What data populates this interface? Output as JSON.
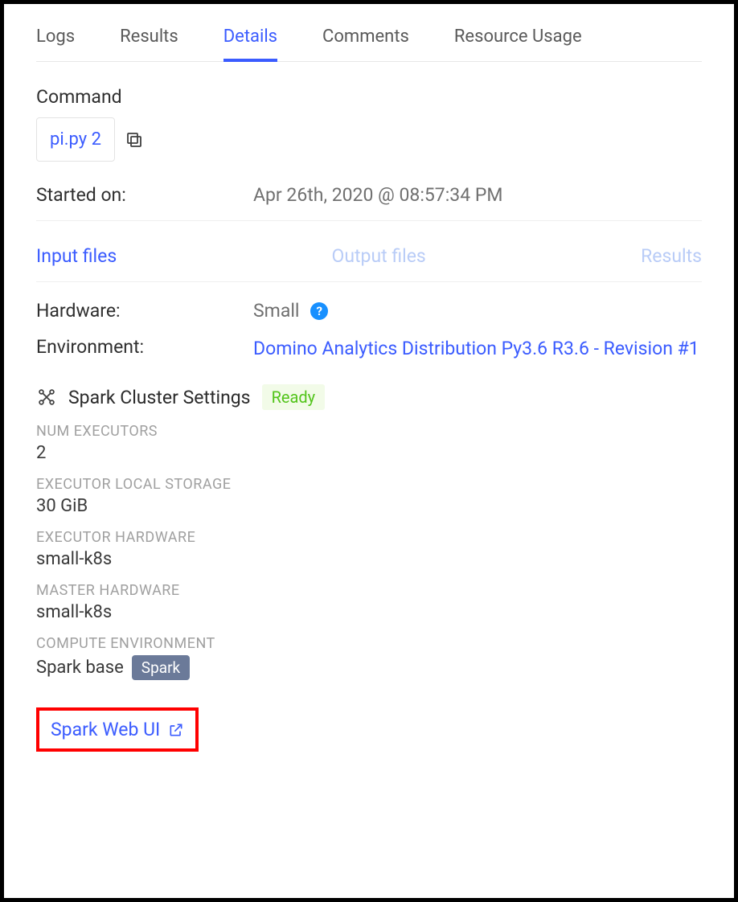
{
  "tabs": {
    "logs": "Logs",
    "results": "Results",
    "details": "Details",
    "comments": "Comments",
    "resource_usage": "Resource Usage"
  },
  "command": {
    "label": "Command",
    "value": "pi.py 2"
  },
  "started": {
    "label": "Started on:",
    "value": "Apr 26th, 2020 @ 08:57:34 PM"
  },
  "files": {
    "input": "Input files",
    "output": "Output files",
    "results": "Results"
  },
  "hardware": {
    "label": "Hardware:",
    "value": "Small"
  },
  "help_glyph": "?",
  "environment": {
    "label": "Environment:",
    "value": "Domino Analytics Distribution Py3.6 R3.6 - Revision #1"
  },
  "spark": {
    "title": "Spark Cluster Settings",
    "status": "Ready",
    "num_executors_label": "NUM EXECUTORS",
    "num_executors": "2",
    "local_storage_label": "EXECUTOR LOCAL STORAGE",
    "local_storage": "30 GiB",
    "executor_hw_label": "EXECUTOR HARDWARE",
    "executor_hw": "small-k8s",
    "master_hw_label": "MASTER HARDWARE",
    "master_hw": "small-k8s",
    "compute_env_label": "COMPUTE ENVIRONMENT",
    "compute_env": "Spark base",
    "compute_env_chip": "Spark",
    "web_ui": "Spark Web UI"
  }
}
